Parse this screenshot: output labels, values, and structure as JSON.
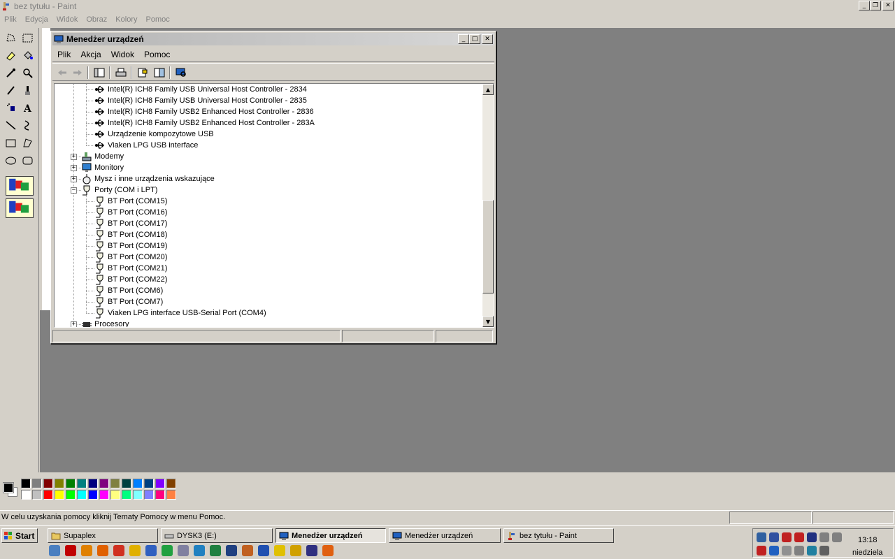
{
  "paint": {
    "title": "bez tytułu - Paint",
    "menu": [
      "Plik",
      "Edycja",
      "Widok",
      "Obraz",
      "Kolory",
      "Pomoc"
    ],
    "status_text": "W celu uzyskania pomocy kliknij Tematy Pomocy w menu Pomoc.",
    "palette_top": [
      "#000000",
      "#808080",
      "#800000",
      "#808000",
      "#008000",
      "#008080",
      "#000080",
      "#800080",
      "#808040",
      "#004040",
      "#0080ff",
      "#004080",
      "#8000ff",
      "#804000"
    ],
    "palette_bottom": [
      "#ffffff",
      "#c0c0c0",
      "#ff0000",
      "#ffff00",
      "#00ff00",
      "#00ffff",
      "#0000ff",
      "#ff00ff",
      "#ffff80",
      "#00ff80",
      "#80ffff",
      "#8080ff",
      "#ff0080",
      "#ff8040"
    ]
  },
  "devmgr": {
    "title": "Menedżer urządzeń",
    "menu": [
      "Plik",
      "Akcja",
      "Widok",
      "Pomoc"
    ],
    "tree": [
      {
        "label": "Intel(R) ICH8 Family USB Universal Host Controller - 2834",
        "level": 2,
        "icon": "usb-icon"
      },
      {
        "label": "Intel(R) ICH8 Family USB Universal Host Controller - 2835",
        "level": 2,
        "icon": "usb-icon"
      },
      {
        "label": "Intel(R) ICH8 Family USB2 Enhanced Host Controller - 2836",
        "level": 2,
        "icon": "usb-icon"
      },
      {
        "label": "Intel(R) ICH8 Family USB2 Enhanced Host Controller - 283A",
        "level": 2,
        "icon": "usb-icon"
      },
      {
        "label": "Urządzenie kompozytowe USB",
        "level": 2,
        "icon": "usb-icon"
      },
      {
        "label": "Viaken LPG USB interface",
        "level": 2,
        "icon": "usb-icon"
      },
      {
        "label": "Modemy",
        "level": 1,
        "icon": "modem-icon",
        "expander": "+"
      },
      {
        "label": "Monitory",
        "level": 1,
        "icon": "monitor-icon",
        "expander": "+"
      },
      {
        "label": "Mysz i inne urządzenia wskazujące",
        "level": 1,
        "icon": "mouse-icon",
        "expander": "+"
      },
      {
        "label": "Porty (COM i LPT)",
        "level": 1,
        "icon": "port-icon",
        "expander": "-"
      },
      {
        "label": "BT Port (COM15)",
        "level": 2,
        "icon": "port-icon"
      },
      {
        "label": "BT Port (COM16)",
        "level": 2,
        "icon": "port-icon"
      },
      {
        "label": "BT Port (COM17)",
        "level": 2,
        "icon": "port-icon"
      },
      {
        "label": "BT Port (COM18)",
        "level": 2,
        "icon": "port-icon"
      },
      {
        "label": "BT Port (COM19)",
        "level": 2,
        "icon": "port-icon"
      },
      {
        "label": "BT Port (COM20)",
        "level": 2,
        "icon": "port-icon"
      },
      {
        "label": "BT Port (COM21)",
        "level": 2,
        "icon": "port-icon"
      },
      {
        "label": "BT Port (COM22)",
        "level": 2,
        "icon": "port-icon"
      },
      {
        "label": "BT Port (COM6)",
        "level": 2,
        "icon": "port-icon"
      },
      {
        "label": "BT Port (COM7)",
        "level": 2,
        "icon": "port-icon"
      },
      {
        "label": "Viaken LPG interface USB-Serial Port (COM4)",
        "level": 2,
        "icon": "port-icon"
      },
      {
        "label": "Procesory",
        "level": 1,
        "icon": "cpu-icon",
        "expander": "+"
      }
    ]
  },
  "taskbar": {
    "start_label": "Start",
    "tasks": [
      {
        "label": "Supaplex",
        "icon": "folder-icon",
        "active": false
      },
      {
        "label": "DYSK3 (E:)",
        "icon": "drive-icon",
        "active": false
      },
      {
        "label": "Menedżer urządzeń",
        "icon": "computer-icon",
        "active": true
      },
      {
        "label": "Menedżer urządzeń",
        "icon": "computer-icon",
        "active": false
      },
      {
        "label": "bez tytułu - Paint",
        "icon": "paint-icon",
        "active": false
      }
    ],
    "clock": "13:18",
    "day": "niedziela",
    "quicklaunch_colors": [
      "#4a7fc0",
      "#c00000",
      "#e08000",
      "#e06000",
      "#d03020",
      "#e0b000",
      "#3060c0",
      "#20a040",
      "#8080a0",
      "#2080c0",
      "#208040",
      "#204080",
      "#c06020",
      "#2050b0",
      "#e0c000",
      "#d0a000",
      "#303080",
      "#e06010"
    ],
    "tray_colors": [
      "#3060a0",
      "#3050a0",
      "#c02020",
      "#c02020",
      "#203080",
      "#808080",
      "#808080",
      "#c02020",
      "#2060c0",
      "#909090",
      "#808080",
      "#2080a0",
      "#606060"
    ]
  }
}
